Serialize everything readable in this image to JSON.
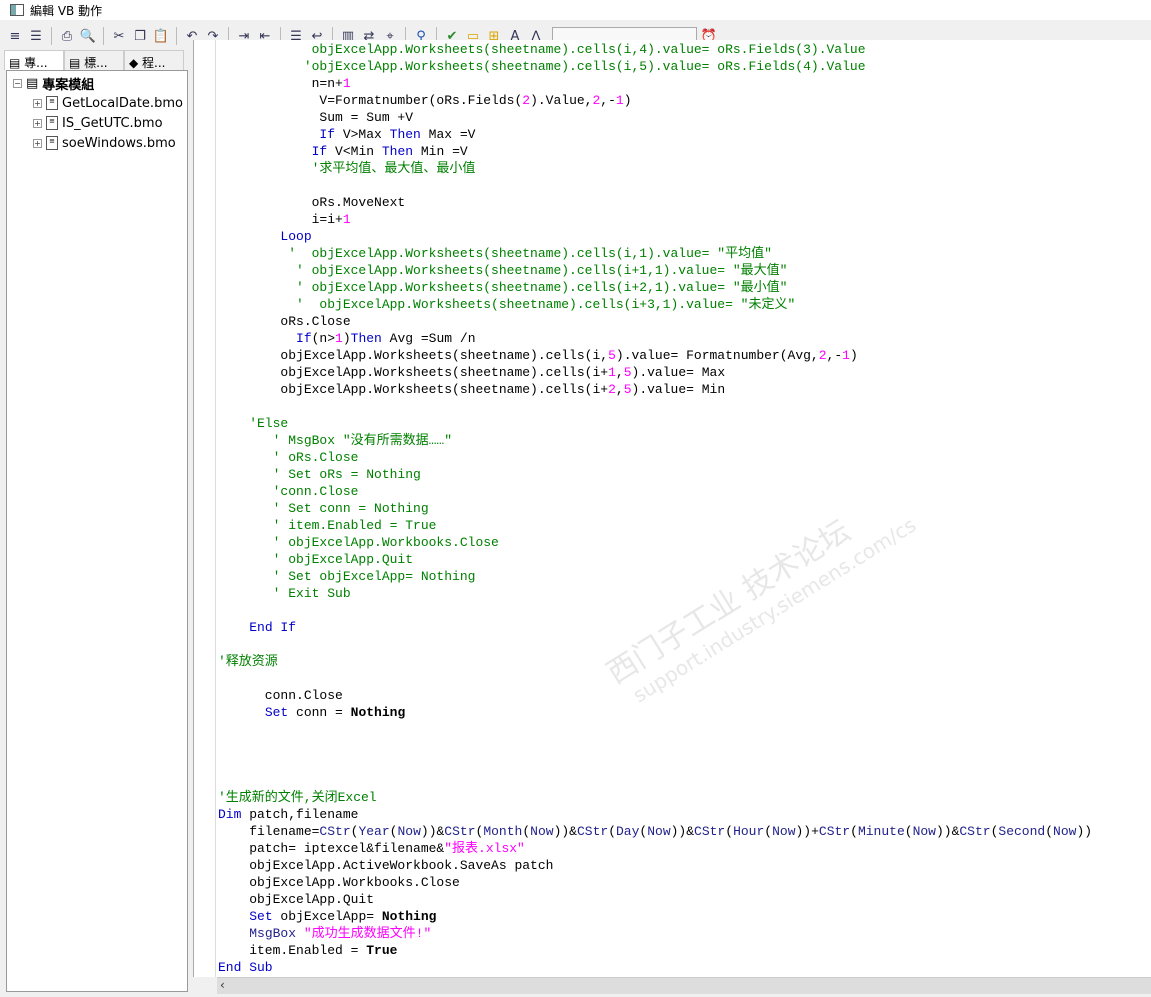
{
  "window": {
    "title": "編輯 VB 動作"
  },
  "toolbar": {
    "icons": [
      "grip",
      "align",
      "print",
      "print-preview",
      "cut",
      "copy",
      "paste",
      "undo",
      "redo",
      "indent",
      "outdent",
      "comment",
      "uncomment",
      "find",
      "replace",
      "find-next",
      "tag",
      "check",
      "folder",
      "add-folder",
      "font",
      "compass",
      "timer"
    ],
    "search_value": ""
  },
  "left_panel": {
    "tabs": [
      {
        "label": "專..."
      },
      {
        "label": "標..."
      },
      {
        "label": "程..."
      }
    ],
    "root": "專案模組",
    "items": [
      {
        "label": "GetLocalDate.bmo"
      },
      {
        "label": "IS_GetUTC.bmo"
      },
      {
        "label": "soeWindows.bmo"
      }
    ]
  },
  "watermark": {
    "line1": "西门子工业  技术论坛",
    "line2": "support.industry.siemens.com/cs"
  },
  "colors": {
    "comment": "#008000",
    "keyword": "#0000c8",
    "string": "#ff00ff",
    "number": "#ff00ff"
  },
  "code": {
    "lines": [
      [
        [
          "            objExcelApp.Worksheets(sheetname).cells(i,4).value= oRs.Fields(3).Value",
          "c"
        ]
      ],
      [
        [
          "           'objExcelApp.Worksheets(sheetname).cells(i,5).value= oRs.Fields(4).Value",
          "c"
        ]
      ],
      [
        [
          "            n=n+",
          ""
        ],
        [
          "1",
          "n"
        ]
      ],
      [
        [
          "             V=Formatnumber(oRs.Fields(",
          ""
        ],
        [
          "2",
          "n"
        ],
        [
          ").Value,",
          ""
        ],
        [
          "2",
          "n"
        ],
        [
          ",-",
          ""
        ],
        [
          "1",
          "n"
        ],
        [
          ")",
          ""
        ]
      ],
      [
        [
          "             Sum = Sum +V",
          ""
        ]
      ],
      [
        [
          "             ",
          ""
        ],
        [
          "If",
          "k"
        ],
        [
          " V>Max ",
          ""
        ],
        [
          "Then",
          "k"
        ],
        [
          " Max =V",
          ""
        ]
      ],
      [
        [
          "            ",
          ""
        ],
        [
          "If",
          "k"
        ],
        [
          " V<Min ",
          ""
        ],
        [
          "Then",
          "k"
        ],
        [
          " Min =V",
          ""
        ]
      ],
      [
        [
          "            '求平均值、最大值、最小值",
          "c"
        ]
      ],
      [
        [
          "",
          ""
        ]
      ],
      [
        [
          "            oRs.MoveNext",
          ""
        ]
      ],
      [
        [
          "            i=i+",
          ""
        ],
        [
          "1",
          "n"
        ]
      ],
      [
        [
          "        ",
          ""
        ],
        [
          "Loop",
          "k"
        ]
      ],
      [
        [
          "         '  objExcelApp.Worksheets(sheetname).cells(i,1).value= \"平均值\"",
          "c"
        ]
      ],
      [
        [
          "          ' objExcelApp.Worksheets(sheetname).cells(i+1,1).value= \"最大值\"",
          "c"
        ]
      ],
      [
        [
          "          ' objExcelApp.Worksheets(sheetname).cells(i+2,1).value= \"最小值\"",
          "c"
        ]
      ],
      [
        [
          "          '  objExcelApp.Worksheets(sheetname).cells(i+3,1).value= \"未定义\"",
          "c"
        ]
      ],
      [
        [
          "        oRs.Close",
          ""
        ]
      ],
      [
        [
          "          ",
          ""
        ],
        [
          "If",
          "k"
        ],
        [
          "(n>",
          ""
        ],
        [
          "1",
          "n"
        ],
        [
          ")",
          ""
        ],
        [
          "Then",
          "k"
        ],
        [
          " Avg =Sum /n",
          ""
        ]
      ],
      [
        [
          "        objExcelApp.Worksheets(sheetname).cells(i,",
          ""
        ],
        [
          "5",
          "n"
        ],
        [
          ").value= Formatnumber(Avg,",
          ""
        ],
        [
          "2",
          "n"
        ],
        [
          ",-",
          ""
        ],
        [
          "1",
          "n"
        ],
        [
          ")",
          ""
        ]
      ],
      [
        [
          "        objExcelApp.Worksheets(sheetname).cells(i+",
          ""
        ],
        [
          "1",
          "n"
        ],
        [
          ",",
          ""
        ],
        [
          "5",
          "n"
        ],
        [
          ").value= Max",
          ""
        ]
      ],
      [
        [
          "        objExcelApp.Worksheets(sheetname).cells(i+",
          ""
        ],
        [
          "2",
          "n"
        ],
        [
          ",",
          ""
        ],
        [
          "5",
          "n"
        ],
        [
          ").value= Min",
          ""
        ]
      ],
      [
        [
          "",
          ""
        ]
      ],
      [
        [
          "    'Else",
          "c"
        ]
      ],
      [
        [
          "       ' MsgBox \"没有所需数据……\"",
          "c"
        ]
      ],
      [
        [
          "       ' oRs.Close",
          "c"
        ]
      ],
      [
        [
          "       ' Set oRs = Nothing",
          "c"
        ]
      ],
      [
        [
          "       'conn.Close",
          "c"
        ]
      ],
      [
        [
          "       ' Set conn = Nothing",
          "c"
        ]
      ],
      [
        [
          "       ' item.Enabled = True",
          "c"
        ]
      ],
      [
        [
          "       ' objExcelApp.Workbooks.Close",
          "c"
        ]
      ],
      [
        [
          "       ' objExcelApp.Quit",
          "c"
        ]
      ],
      [
        [
          "       ' Set objExcelApp= Nothing",
          "c"
        ]
      ],
      [
        [
          "       ' Exit Sub",
          "c"
        ]
      ],
      [
        [
          "",
          ""
        ]
      ],
      [
        [
          "    ",
          ""
        ],
        [
          "End If",
          "k"
        ]
      ],
      [
        [
          "",
          ""
        ]
      ],
      [
        [
          "'释放资源",
          "c"
        ]
      ],
      [
        [
          "",
          ""
        ]
      ],
      [
        [
          "      conn.Close",
          ""
        ]
      ],
      [
        [
          "      ",
          ""
        ],
        [
          "Set",
          "k"
        ],
        [
          " conn = ",
          ""
        ],
        [
          "Nothing",
          "b"
        ]
      ],
      [
        [
          "",
          ""
        ]
      ],
      [
        [
          "",
          ""
        ]
      ],
      [
        [
          "",
          ""
        ]
      ],
      [
        [
          "",
          ""
        ]
      ],
      [
        [
          "'生成新的文件,关闭Excel",
          "c"
        ]
      ],
      [
        [
          "Dim",
          "k"
        ],
        [
          " patch,filename",
          ""
        ]
      ],
      [
        [
          "    filename=",
          ""
        ],
        [
          "CStr",
          "f"
        ],
        [
          "(",
          ""
        ],
        [
          "Year",
          "f"
        ],
        [
          "(",
          ""
        ],
        [
          "Now",
          "f"
        ],
        [
          "))&",
          ""
        ],
        [
          "CStr",
          "f"
        ],
        [
          "(",
          ""
        ],
        [
          "Month",
          "f"
        ],
        [
          "(",
          ""
        ],
        [
          "Now",
          "f"
        ],
        [
          "))&",
          ""
        ],
        [
          "CStr",
          "f"
        ],
        [
          "(",
          ""
        ],
        [
          "Day",
          "f"
        ],
        [
          "(",
          ""
        ],
        [
          "Now",
          "f"
        ],
        [
          "))&",
          ""
        ],
        [
          "CStr",
          "f"
        ],
        [
          "(",
          ""
        ],
        [
          "Hour",
          "f"
        ],
        [
          "(",
          ""
        ],
        [
          "Now",
          "f"
        ],
        [
          "))+",
          ""
        ],
        [
          "CStr",
          "f"
        ],
        [
          "(",
          ""
        ],
        [
          "Minute",
          "f"
        ],
        [
          "(",
          ""
        ],
        [
          "Now",
          "f"
        ],
        [
          "))&",
          ""
        ],
        [
          "CStr",
          "f"
        ],
        [
          "(",
          ""
        ],
        [
          "Second",
          "f"
        ],
        [
          "(",
          ""
        ],
        [
          "Now",
          "f"
        ],
        [
          "))",
          ""
        ]
      ],
      [
        [
          "    patch= iptexcel&filename&",
          ""
        ],
        [
          "\"报表.xlsx\"",
          "s"
        ]
      ],
      [
        [
          "    objExcelApp.ActiveWorkbook.SaveAs patch",
          ""
        ]
      ],
      [
        [
          "    objExcelApp.Workbooks.Close",
          ""
        ]
      ],
      [
        [
          "    objExcelApp.Quit",
          ""
        ]
      ],
      [
        [
          "    ",
          ""
        ],
        [
          "Set",
          "k"
        ],
        [
          " objExcelApp= ",
          ""
        ],
        [
          "Nothing",
          "b"
        ]
      ],
      [
        [
          "    ",
          ""
        ],
        [
          "MsgBox",
          "f"
        ],
        [
          " ",
          ""
        ],
        [
          "\"成功生成数据文件!\"",
          "s"
        ]
      ],
      [
        [
          "    item.Enabled = ",
          ""
        ],
        [
          "True",
          "b"
        ]
      ],
      [
        [
          "End Sub",
          "k"
        ]
      ]
    ]
  }
}
